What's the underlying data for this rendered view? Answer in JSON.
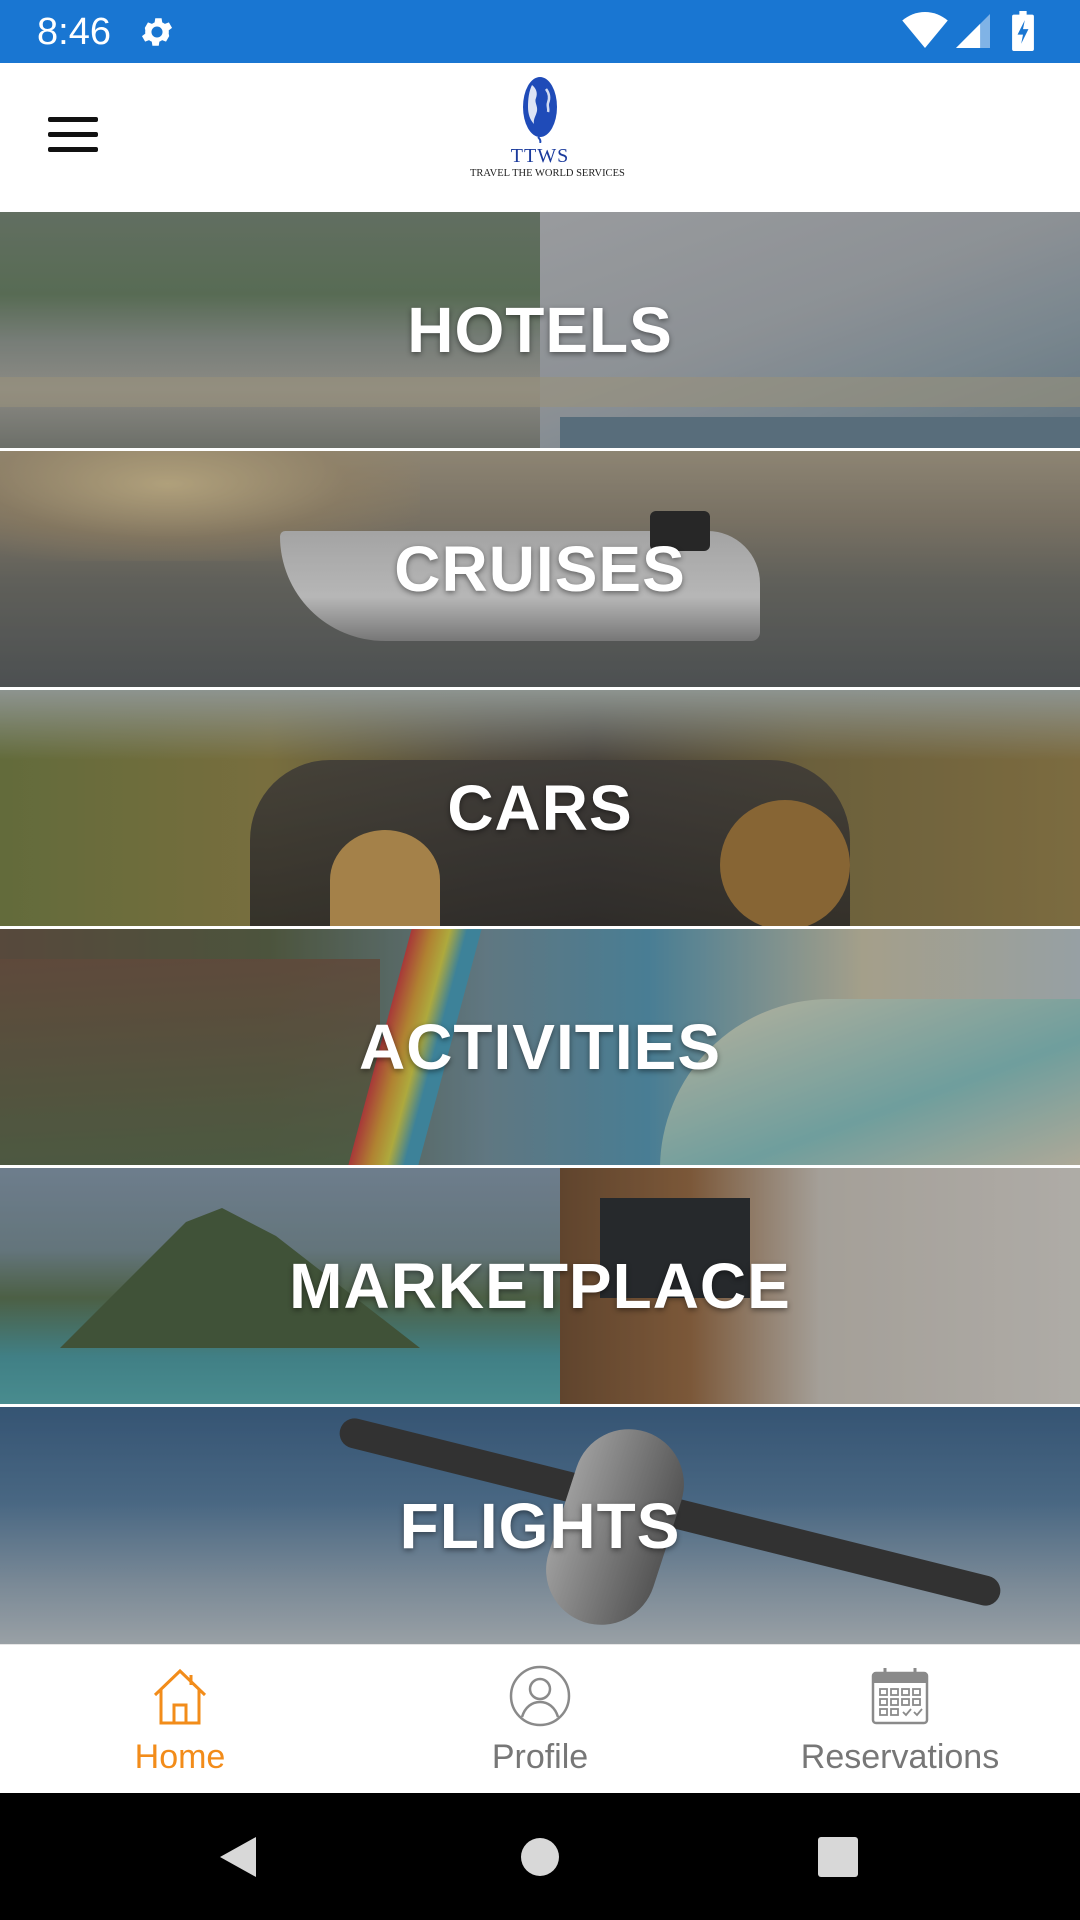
{
  "status_bar": {
    "time": "8:46"
  },
  "app_bar": {
    "logo_abbr": "TTWS",
    "logo_name": "TRAVEL THE WORLD SERVICES"
  },
  "categories": [
    {
      "label": "HOTELS"
    },
    {
      "label": "CRUISES"
    },
    {
      "label": "CARS"
    },
    {
      "label": "ACTIVITIES"
    },
    {
      "label": "MARKETPLACE"
    },
    {
      "label": "FLIGHTS"
    }
  ],
  "bottom_nav": {
    "active_color": "#f28c1a",
    "inactive_color": "#777777",
    "items": [
      {
        "label": "Home",
        "icon": "home-icon",
        "active": true
      },
      {
        "label": "Profile",
        "icon": "user-icon",
        "active": false
      },
      {
        "label": "Reservations",
        "icon": "calendar-icon",
        "active": false
      }
    ]
  },
  "colors": {
    "status_bar": "#1976d2",
    "accent": "#f28c1a"
  }
}
